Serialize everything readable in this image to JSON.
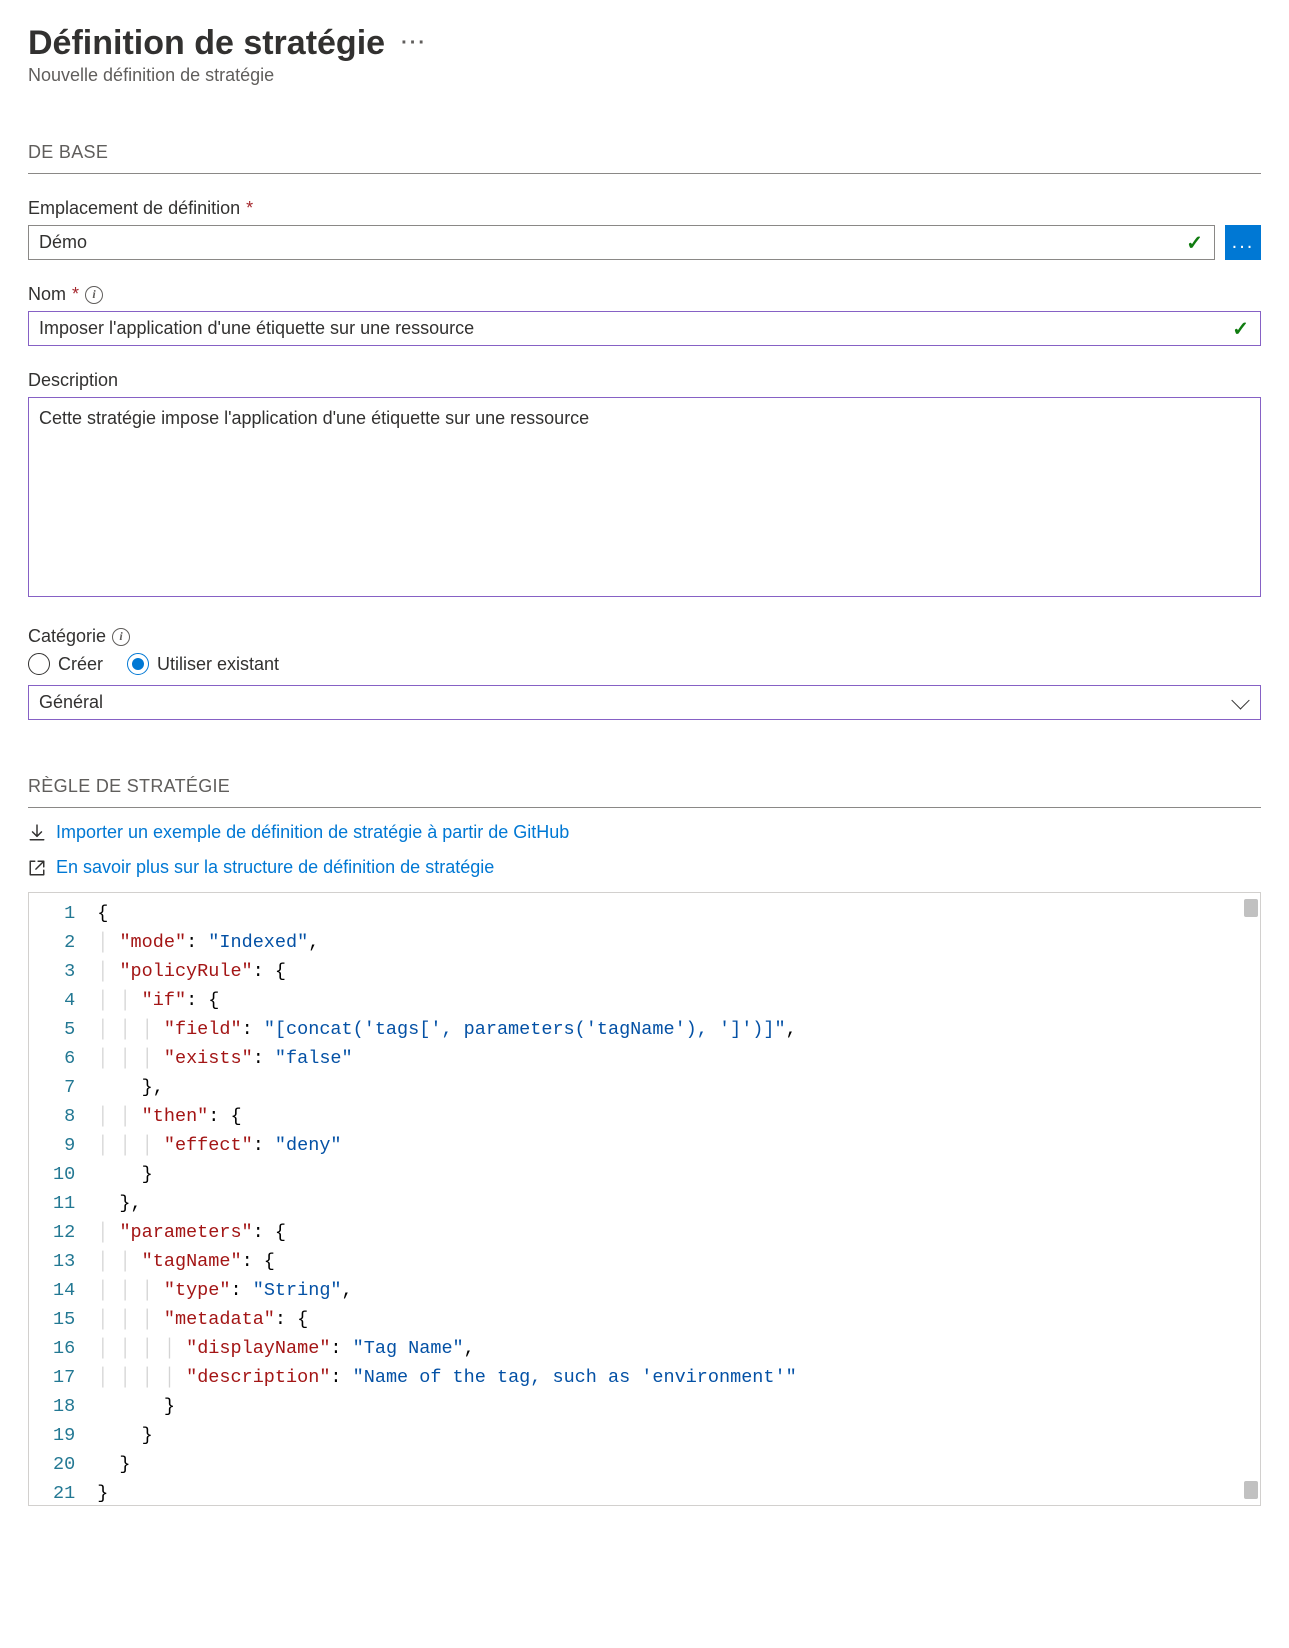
{
  "header": {
    "title": "Définition de stratégie",
    "subtitle": "Nouvelle définition de stratégie"
  },
  "sections": {
    "basics": "DE BASE",
    "rule": "RÈGLE DE STRATÉGIE"
  },
  "fields": {
    "location_label": "Emplacement de définition",
    "location_value": "Démo",
    "name_label": "Nom",
    "name_value": "Imposer l'application d'une étiquette sur une ressource",
    "description_label": "Description",
    "description_value": "Cette stratégie impose l'application d'une étiquette sur une ressource",
    "category_label": "Catégorie",
    "category_create": "Créer",
    "category_existing": "Utiliser existant",
    "category_value": "Général"
  },
  "links": {
    "import_github": "Importer un exemple de définition de stratégie à partir de GitHub",
    "learn_more": "En savoir plus sur la structure de définition de stratégie"
  },
  "code": {
    "lines": [
      [
        [
          "{",
          "punc"
        ]
      ],
      [
        [
          "  ",
          ""
        ],
        [
          "\"mode\"",
          "key"
        ],
        [
          ": ",
          "punc"
        ],
        [
          "\"Indexed\"",
          "str"
        ],
        [
          ",",
          "punc"
        ]
      ],
      [
        [
          "  ",
          ""
        ],
        [
          "\"policyRule\"",
          "key"
        ],
        [
          ": {",
          "punc"
        ]
      ],
      [
        [
          "    ",
          ""
        ],
        [
          "\"if\"",
          "key"
        ],
        [
          ": {",
          "punc"
        ]
      ],
      [
        [
          "      ",
          ""
        ],
        [
          "\"field\"",
          "key"
        ],
        [
          ": ",
          "punc"
        ],
        [
          "\"[concat('tags[', parameters('tagName'), ']')]\"",
          "str"
        ],
        [
          ",",
          "punc"
        ]
      ],
      [
        [
          "      ",
          ""
        ],
        [
          "\"exists\"",
          "key"
        ],
        [
          ": ",
          "punc"
        ],
        [
          "\"false\"",
          "str"
        ]
      ],
      [
        [
          "    },",
          "punc"
        ]
      ],
      [
        [
          "    ",
          ""
        ],
        [
          "\"then\"",
          "key"
        ],
        [
          ": {",
          "punc"
        ]
      ],
      [
        [
          "      ",
          ""
        ],
        [
          "\"effect\"",
          "key"
        ],
        [
          ": ",
          "punc"
        ],
        [
          "\"deny\"",
          "str"
        ]
      ],
      [
        [
          "    }",
          "punc"
        ]
      ],
      [
        [
          "  },",
          "punc"
        ]
      ],
      [
        [
          "  ",
          ""
        ],
        [
          "\"parameters\"",
          "key"
        ],
        [
          ": {",
          "punc"
        ]
      ],
      [
        [
          "    ",
          ""
        ],
        [
          "\"tagName\"",
          "key"
        ],
        [
          ": {",
          "punc"
        ]
      ],
      [
        [
          "      ",
          ""
        ],
        [
          "\"type\"",
          "key"
        ],
        [
          ": ",
          "punc"
        ],
        [
          "\"String\"",
          "str"
        ],
        [
          ",",
          "punc"
        ]
      ],
      [
        [
          "      ",
          ""
        ],
        [
          "\"metadata\"",
          "key"
        ],
        [
          ": {",
          "punc"
        ]
      ],
      [
        [
          "        ",
          ""
        ],
        [
          "\"displayName\"",
          "key"
        ],
        [
          ": ",
          "punc"
        ],
        [
          "\"Tag Name\"",
          "str"
        ],
        [
          ",",
          "punc"
        ]
      ],
      [
        [
          "        ",
          ""
        ],
        [
          "\"description\"",
          "key"
        ],
        [
          ": ",
          "punc"
        ],
        [
          "\"Name of the tag, such as 'environment'\"",
          "str"
        ]
      ],
      [
        [
          "      }",
          "punc"
        ]
      ],
      [
        [
          "    }",
          "punc"
        ]
      ],
      [
        [
          "  }",
          "punc"
        ]
      ],
      [
        [
          "}",
          "punc"
        ]
      ]
    ]
  }
}
